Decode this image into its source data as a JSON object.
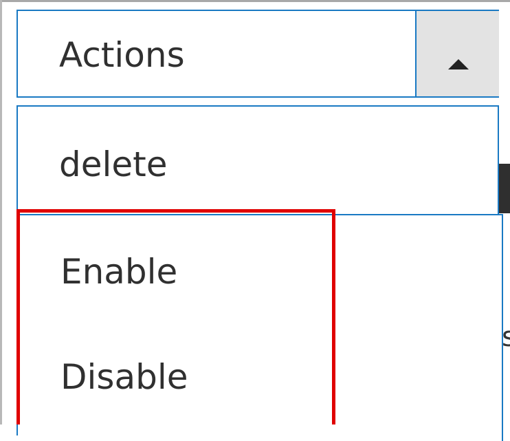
{
  "select": {
    "label": "Actions",
    "expanded": true,
    "toggle_icon": "triangle-up-icon"
  },
  "menu": {
    "items": [
      {
        "label": "delete"
      },
      {
        "label": "Enable"
      },
      {
        "label": "Disable"
      }
    ]
  },
  "background": {
    "clipped_text": "s"
  },
  "colors": {
    "focus_border": "#1979c3",
    "highlight": "#e00000",
    "text": "#303030",
    "toggle_background": "#e3e3e3"
  }
}
